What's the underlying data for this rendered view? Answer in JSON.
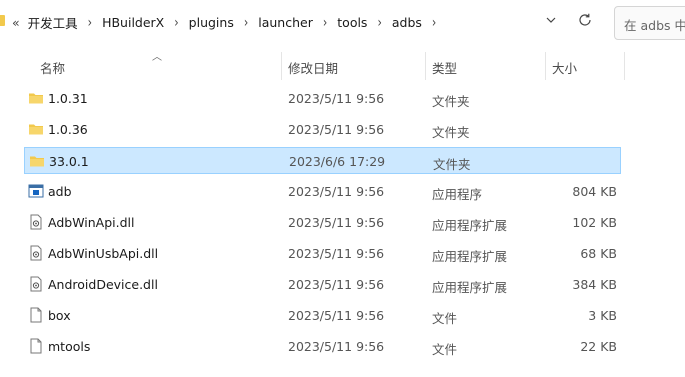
{
  "breadcrumb": {
    "prefix": "«",
    "segments": [
      "开发工具",
      "HBuilderX",
      "plugins",
      "launcher",
      "tools",
      "adbs"
    ],
    "trailing_chevron": "›"
  },
  "search": {
    "placeholder": "在 adbs 中"
  },
  "columns": {
    "name": "名称",
    "date": "修改日期",
    "type": "类型",
    "size": "大小"
  },
  "rows": [
    {
      "name": "1.0.31",
      "date": "2023/5/11 9:56",
      "type": "文件夹",
      "size": "",
      "icon": "folder-icon",
      "selected": false
    },
    {
      "name": "1.0.36",
      "date": "2023/5/11 9:56",
      "type": "文件夹",
      "size": "",
      "icon": "folder-icon",
      "selected": false
    },
    {
      "name": "33.0.1",
      "date": "2023/6/6 17:29",
      "type": "文件夹",
      "size": "",
      "icon": "folder-icon",
      "selected": true
    },
    {
      "name": "adb",
      "date": "2023/5/11 9:56",
      "type": "应用程序",
      "size": "804 KB",
      "icon": "application-icon",
      "selected": false
    },
    {
      "name": "AdbWinApi.dll",
      "date": "2023/5/11 9:56",
      "type": "应用程序扩展",
      "size": "102 KB",
      "icon": "dll-file-icon",
      "selected": false
    },
    {
      "name": "AdbWinUsbApi.dll",
      "date": "2023/5/11 9:56",
      "type": "应用程序扩展",
      "size": "68 KB",
      "icon": "dll-file-icon",
      "selected": false
    },
    {
      "name": "AndroidDevice.dll",
      "date": "2023/5/11 9:56",
      "type": "应用程序扩展",
      "size": "384 KB",
      "icon": "dll-file-icon",
      "selected": false
    },
    {
      "name": "box",
      "date": "2023/5/11 9:56",
      "type": "文件",
      "size": "3 KB",
      "icon": "file-icon",
      "selected": false
    },
    {
      "name": "mtools",
      "date": "2023/5/11 9:56",
      "type": "文件",
      "size": "22 KB",
      "icon": "file-icon",
      "selected": false
    }
  ],
  "colors": {
    "selection_bg": "#cce8ff",
    "selection_border": "#99d1ff",
    "folder": "#f2c94c",
    "app_icon": "#1565c0"
  }
}
